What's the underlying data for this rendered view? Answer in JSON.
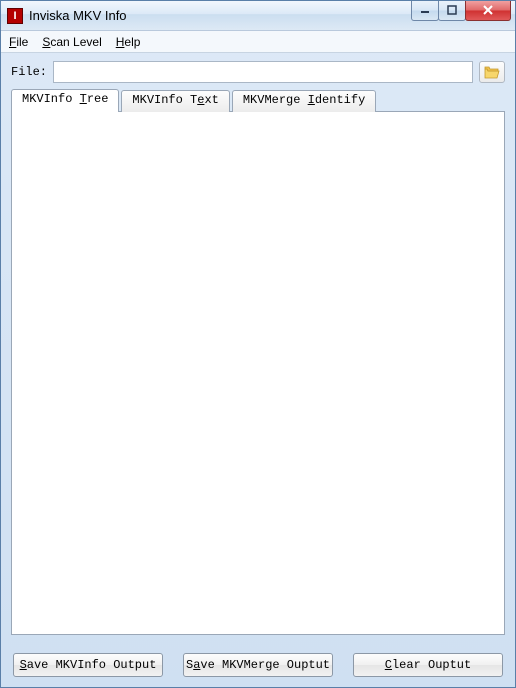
{
  "window": {
    "title": "Inviska MKV Info",
    "icon_letter": "I"
  },
  "menu": {
    "file": {
      "prefix": "",
      "ul": "F",
      "rest": "ile"
    },
    "scan": {
      "prefix": "",
      "ul": "S",
      "rest": "can Level"
    },
    "help": {
      "prefix": "",
      "ul": "H",
      "rest": "elp"
    }
  },
  "file_row": {
    "label": "File:",
    "value": ""
  },
  "tabs": {
    "tree": {
      "prefix": "MKVInfo ",
      "ul": "T",
      "rest": "ree"
    },
    "text": {
      "prefix": "MKVInfo T",
      "ul": "e",
      "rest": "xt"
    },
    "identify": {
      "prefix": "MKVMerge ",
      "ul": "I",
      "rest": "dentify"
    }
  },
  "buttons": {
    "save_mkvinfo": {
      "prefix": "",
      "ul": "S",
      "rest": "ave MKVInfo Output"
    },
    "save_mkvmerge": {
      "prefix": "S",
      "ul": "a",
      "rest": "ve MKVMerge Ouptut"
    },
    "clear": {
      "prefix": "",
      "ul": "C",
      "rest": "lear Ouptut"
    }
  }
}
